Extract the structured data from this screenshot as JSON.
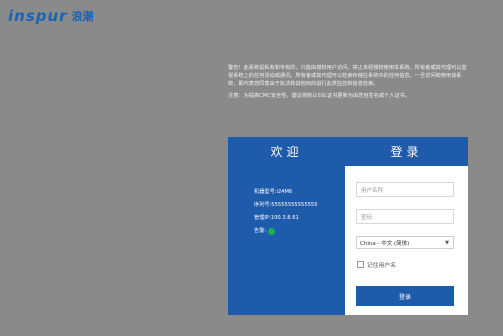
{
  "header": {
    "brand": "inspur",
    "brand_cn": "浪潮"
  },
  "notice": {
    "warning": "警告！此系统是私有和专有的，只能由授权用户访问。禁止未经授权使用本系统。所有者或其代理可以监视系统上的任何活动或通讯。所有者或其代理可以检索存储在系统中的任何信息。一旦访问和使用该系统，即代表您同意由于执法和其他目的进行此类监控和信息检索。",
    "note": "注意：为提高CMC安全性，建议将默认SSL证书更新为由您自签名或个人证书。"
  },
  "welcome": {
    "title": "欢迎",
    "model_label": "机器型号:i24M6",
    "serial_label": "序列号:55555555555555",
    "ip_label": "管理IP:100.3.8.61",
    "alarm_label": "告警:"
  },
  "login": {
    "title": "登录",
    "username_placeholder": "用户名称",
    "password_placeholder": "密码",
    "language_selected": "China - 中文 (简体)",
    "remember_label": "记住用户名",
    "submit_label": "登录"
  },
  "colors": {
    "background": "#8a8a8a",
    "brand_blue": "#1a63b4",
    "panel_blue": "#1f5bab",
    "status_ok": "#19b34b"
  }
}
